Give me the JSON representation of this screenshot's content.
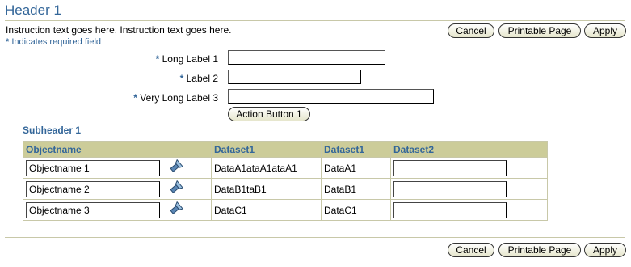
{
  "header": {
    "title": "Header 1"
  },
  "instruction": "Instruction text goes here. Instruction text goes here.",
  "required_note": {
    "star": "*",
    "text": "Indicates required field"
  },
  "top_buttons": {
    "cancel": "Cancel",
    "printable": "Printable Page",
    "apply": "Apply"
  },
  "form": {
    "fields": [
      {
        "star": "*",
        "label": "Long Label 1",
        "value": ""
      },
      {
        "star": "*",
        "label": "Label 2",
        "value": ""
      },
      {
        "star": "*",
        "label": "Very Long Label 3",
        "value": ""
      }
    ],
    "action_button": "Action Button 1"
  },
  "subheader": {
    "title": "Subheader 1"
  },
  "table": {
    "columns": [
      "Objectname",
      "Dataset1",
      "Dataset1",
      "Dataset2"
    ],
    "rows": [
      {
        "objectname": "Objectname 1",
        "d1": "DataA1ataA1ataA1",
        "d2": "DataA1",
        "d3": ""
      },
      {
        "objectname": "Objectname 2",
        "d1": "DataB1taB1",
        "d2": "DataB1",
        "d3": ""
      },
      {
        "objectname": "Objectname 3",
        "d1": "DataC1",
        "d2": "DataC1",
        "d3": ""
      }
    ]
  },
  "bottom_buttons": {
    "cancel": "Cancel",
    "printable": "Printable Page",
    "apply": "Apply"
  },
  "colors": {
    "accent": "#336699",
    "table_header": "#cccc99",
    "rule": "#c8c8a8"
  },
  "icons": {
    "lookup": "flashlight-icon"
  }
}
